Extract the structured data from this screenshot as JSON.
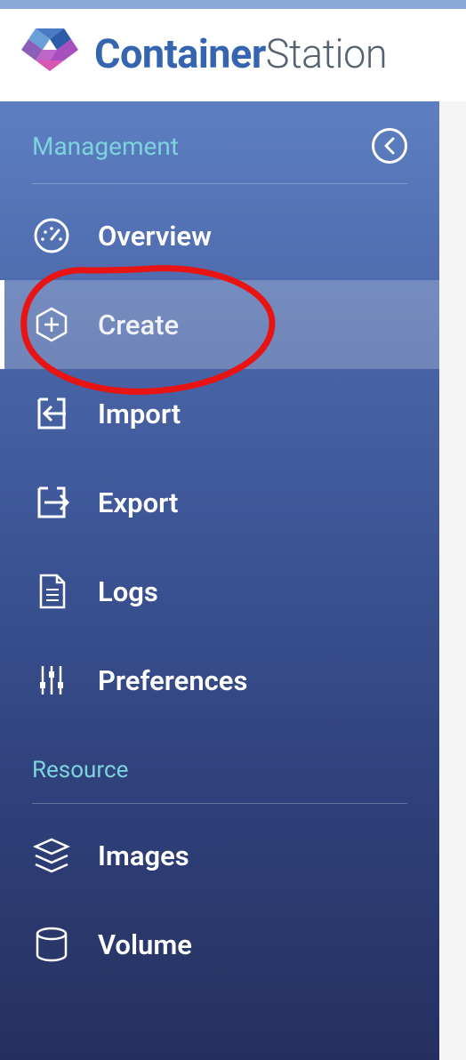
{
  "app": {
    "title_bold": "Container",
    "title_light": "Station"
  },
  "sidebar": {
    "sections": [
      {
        "title": "Management",
        "items": [
          {
            "label": "Overview"
          },
          {
            "label": "Create"
          },
          {
            "label": "Import"
          },
          {
            "label": "Export"
          },
          {
            "label": "Logs"
          },
          {
            "label": "Preferences"
          }
        ]
      },
      {
        "title": "Resource",
        "items": [
          {
            "label": "Images"
          },
          {
            "label": "Volume"
          }
        ]
      }
    ]
  }
}
